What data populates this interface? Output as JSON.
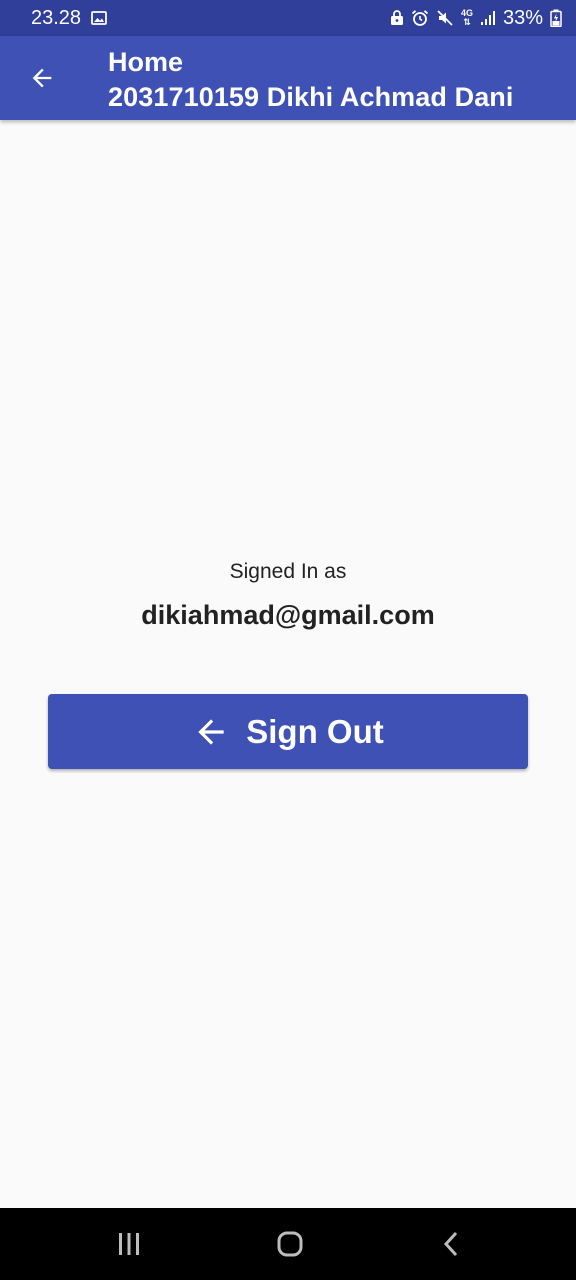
{
  "status_bar": {
    "time": "23.28",
    "network": "4G",
    "battery": "33%",
    "icons": [
      "image-icon",
      "lock-icon",
      "alarm-icon",
      "mute-icon",
      "signal-icon",
      "battery-icon"
    ]
  },
  "app_bar": {
    "title": "Home",
    "subtitle": "2031710159 Dikhi Achmad Dani",
    "back_icon": "arrow-back-icon"
  },
  "account": {
    "signed_in_label": "Signed In as",
    "email": "dikiahmad@gmail.com"
  },
  "sign_out_button": {
    "label": "Sign Out",
    "icon": "arrow-back-icon"
  },
  "nav_bar": {
    "icons": [
      "recents-icon",
      "home-icon",
      "back-icon"
    ]
  },
  "colors": {
    "primary": "#3f51b5",
    "status_bar": "#2f3f9a",
    "background": "#fafafa",
    "text": "#222222",
    "nav_bar": "#000000"
  }
}
